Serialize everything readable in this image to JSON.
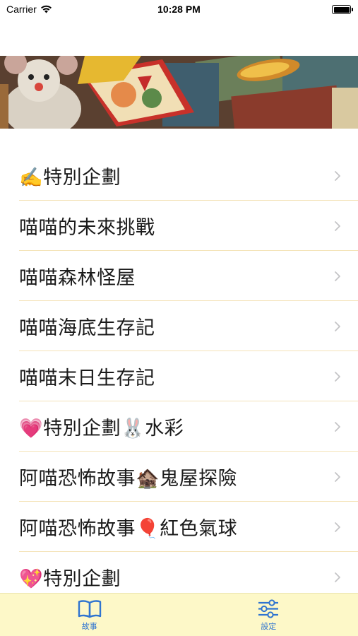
{
  "status_bar": {
    "carrier": "Carrier",
    "time": "10:28 PM",
    "battery_level": 1.0
  },
  "banner": {
    "image_description_icon": "storybook-illustration"
  },
  "stories": [
    {
      "label": "✍️特別企劃"
    },
    {
      "label": "喵喵的未來挑戰"
    },
    {
      "label": "喵喵森林怪屋"
    },
    {
      "label": "喵喵海底生存記"
    },
    {
      "label": "喵喵末日生存記"
    },
    {
      "label": "💗特別企劃🐰水彩"
    },
    {
      "label": "阿喵恐怖故事🏚️鬼屋探險"
    },
    {
      "label": "阿喵恐怖故事🎈紅色氣球"
    },
    {
      "label": "💖特別企劃"
    }
  ],
  "tab_bar": {
    "tabs": [
      {
        "label": "故事",
        "icon": "book-icon",
        "selected": true
      },
      {
        "label": "設定",
        "icon": "sliders-icon",
        "selected": false
      }
    ],
    "accent_color": "#2f74d0",
    "background_color": "#fdf8c8"
  },
  "colors": {
    "separator": "#f4e3b8",
    "chevron": "#c4c4c6"
  }
}
